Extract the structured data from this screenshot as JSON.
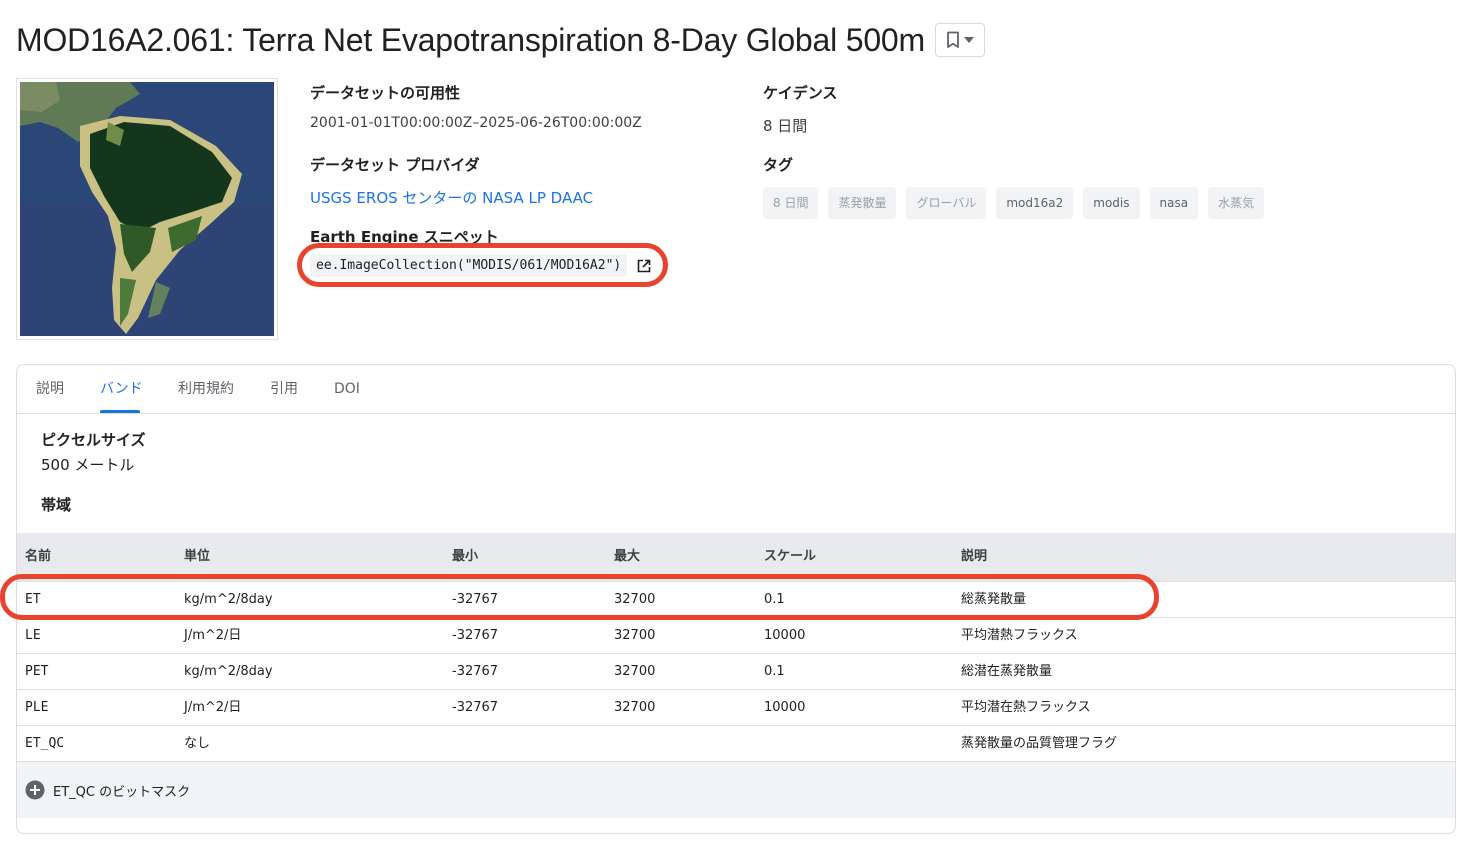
{
  "title": "MOD16A2.061: Terra Net Evapotranspiration 8-Day Global 500m",
  "availability": {
    "label": "データセットの可用性",
    "value": "2001-01-01T00:00:00Z–2025-06-26T00:00:00Z"
  },
  "provider": {
    "label": "データセット プロバイダ",
    "value": "USGS EROS センターの NASA LP DAAC"
  },
  "snippet": {
    "label": "Earth Engine スニペット",
    "code": "ee.ImageCollection(\"MODIS/061/MOD16A2\")"
  },
  "cadence": {
    "label": "ケイデンス",
    "value": "8 日間"
  },
  "tags": {
    "label": "タグ",
    "items": [
      "8 日間",
      "蒸発散量",
      "グローバル",
      "mod16a2",
      "modis",
      "nasa",
      "水蒸気"
    ]
  },
  "tabs": [
    "説明",
    "バンド",
    "利用規約",
    "引用",
    "DOI"
  ],
  "active_tab": "バンド",
  "pixel_size": {
    "label": "ピクセルサイズ",
    "value": "500 メートル"
  },
  "bands_label": "帯域",
  "table": {
    "headers": [
      "名前",
      "単位",
      "最小",
      "最大",
      "スケール",
      "説明"
    ],
    "rows": [
      [
        "ET",
        "kg/m^2/8day",
        "-32767",
        "32700",
        "0.1",
        "総蒸発散量"
      ],
      [
        "LE",
        "J/m^2/日",
        "-32767",
        "32700",
        "10000",
        "平均潜熱フラックス"
      ],
      [
        "PET",
        "kg/m^2/8day",
        "-32767",
        "32700",
        "0.1",
        "総潜在蒸発散量"
      ],
      [
        "PLE",
        "J/m^2/日",
        "-32767",
        "32700",
        "10000",
        "平均潜在熱フラックス"
      ],
      [
        "ET_QC",
        "なし",
        "",
        "",
        "",
        "蒸発散量の品質管理フラグ"
      ]
    ]
  },
  "bitmask": {
    "label": "ET_QC のビットマスク"
  },
  "colors": {
    "accent": "#1a73e8",
    "annotation": "#e8432c",
    "header_bg": "#e8eaed"
  }
}
